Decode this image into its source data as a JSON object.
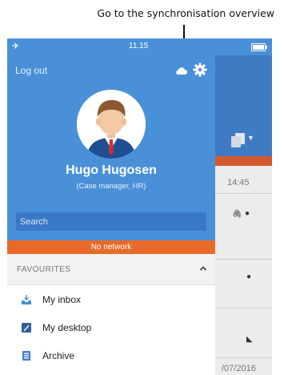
{
  "callout": {
    "text": "Go to the synchronisation overview"
  },
  "statusbar": {
    "time": "11.15"
  },
  "drawer": {
    "logout_label": "Log out",
    "user_name": "Hugo Hugosen",
    "user_role": "(Case manager, HR)",
    "search_placeholder": "Search",
    "network_status": "No network",
    "favourites_title": "FAVOURITES",
    "items": [
      {
        "label": "My inbox",
        "icon": "inbox-icon"
      },
      {
        "label": "My desktop",
        "icon": "desktop-icon"
      },
      {
        "label": "Archive",
        "icon": "archive-icon"
      }
    ]
  },
  "background_list": {
    "time": "14:45",
    "date": "/07/2016"
  },
  "colors": {
    "accent": "#4a90d9",
    "header_bg": "#3f7bc2",
    "network_warning": "#e86a2a",
    "inbox_icon": "#4a90d9",
    "desktop_icon": "#2f5f95",
    "archive_icon": "#3d7fd0"
  }
}
